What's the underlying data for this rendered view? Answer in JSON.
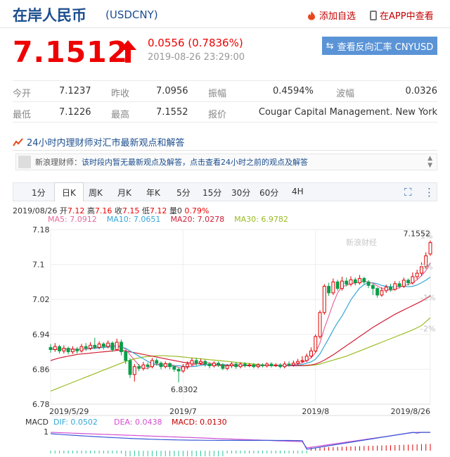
{
  "header": {
    "title": "在岸人民币",
    "code": "(USDCNY)",
    "fav_label": "添加自选",
    "app_label": "在APP中查看"
  },
  "quote": {
    "price": "7.1512",
    "change": "0.0556 (0.7836%)",
    "timestamp": "2019-08-26 23:29:00",
    "reverse_label": "查看反向汇率 CNYUSD"
  },
  "stats": {
    "open_label": "今开",
    "open": "7.1237",
    "prev_label": "昨收",
    "prev": "7.0956",
    "amp_label": "振幅",
    "amp": "0.4594%",
    "wave_label": "波幅",
    "wave": "0.0326",
    "low_label": "最低",
    "low": "7.1226",
    "high_label": "最高",
    "high": "7.1552",
    "quoter_label": "报价",
    "quoter": "Cougar Capital Management. New York"
  },
  "opinion": {
    "heading": "24小时内理财师对汇市最新观点和解答",
    "name": "新浪理财师：",
    "message": "该时段内暂无最新观点及解答，点击查看24小时之前的观点及解答"
  },
  "tabs": [
    "1分",
    "日K",
    "周K",
    "月K",
    "年K",
    "5分",
    "15分",
    "30分",
    "60分",
    "4H"
  ],
  "ohlc": {
    "date": "2019/08/26",
    "open_label": "开",
    "open": "7.12",
    "high_label": "高",
    "high": "7.16",
    "close_label": "收",
    "close": "7.15",
    "low_label": "低",
    "low": "7.12",
    "vol_label": "量",
    "vol": "0",
    "pct": "0.79%",
    "ma5": "MA5: 7.0912",
    "ma10": "MA10: 7.0651",
    "ma20": "MA20: 7.0278",
    "ma30": "MA30: 6.9782"
  },
  "macd": {
    "label": "MACD",
    "dif": "DIF: 0.0502",
    "dea": "DEA: 0.0438",
    "macd": "MACD: 0.0130",
    "tick": "1"
  },
  "colors": {
    "up": "#e00000",
    "down": "#0b9e4a",
    "ma5": "#e8689a",
    "ma10": "#35a7d6",
    "ma20": "#d22038",
    "ma30": "#99bb22"
  },
  "chart_data": {
    "type": "candlestick",
    "y_ticks": [
      "7.18",
      "7.1",
      "7.02",
      "6.94",
      "6.86",
      "6.78"
    ],
    "y_tick_values": [
      7.18,
      7.1,
      7.02,
      6.94,
      6.86,
      6.78
    ],
    "pct_ticks": [
      "2%",
      "1%",
      "0%",
      "-1%",
      "-2%"
    ],
    "x_labels": [
      "2019/5/29",
      "2019/7",
      "2019/8",
      "2019/8/26"
    ],
    "x_label_index": [
      0,
      30,
      60,
      86
    ],
    "ylim": [
      6.78,
      7.18
    ],
    "annotations": [
      {
        "text": "7.1552",
        "index": 86,
        "value": 7.1552
      },
      {
        "text": "6.8302",
        "index": 29,
        "value": 6.8302
      }
    ],
    "watermark": "新浪财经",
    "candles": [
      [
        6.91,
        6.905,
        6.918,
        6.898
      ],
      [
        6.905,
        6.912,
        6.92,
        6.9
      ],
      [
        6.912,
        6.902,
        6.916,
        6.896
      ],
      [
        6.902,
        6.908,
        6.915,
        6.896
      ],
      [
        6.908,
        6.9,
        6.912,
        6.894
      ],
      [
        6.9,
        6.906,
        6.913,
        6.895
      ],
      [
        6.906,
        6.902,
        6.911,
        6.896
      ],
      [
        6.902,
        6.912,
        6.918,
        6.898
      ],
      [
        6.912,
        6.908,
        6.92,
        6.902
      ],
      [
        6.908,
        6.915,
        6.922,
        6.904
      ],
      [
        6.915,
        6.91,
        6.932,
        6.906
      ],
      [
        6.91,
        6.918,
        6.924,
        6.906
      ],
      [
        6.918,
        6.912,
        6.922,
        6.905
      ],
      [
        6.912,
        6.92,
        6.926,
        6.908
      ],
      [
        6.92,
        6.905,
        6.924,
        6.9
      ],
      [
        6.905,
        6.922,
        6.93,
        6.903
      ],
      [
        6.922,
        6.9,
        6.928,
        6.892
      ],
      [
        6.9,
        6.88,
        6.904,
        6.872
      ],
      [
        6.88,
        6.848,
        6.885,
        6.84
      ],
      [
        6.848,
        6.866,
        6.872,
        6.832
      ],
      [
        6.866,
        6.862,
        6.872,
        6.856
      ],
      [
        6.862,
        6.87,
        6.877,
        6.857
      ],
      [
        6.87,
        6.866,
        6.875,
        6.86
      ],
      [
        6.866,
        6.88,
        6.886,
        6.862
      ],
      [
        6.88,
        6.874,
        6.885,
        6.868
      ],
      [
        6.874,
        6.866,
        6.878,
        6.86
      ],
      [
        6.866,
        6.873,
        6.878,
        6.862
      ],
      [
        6.873,
        6.866,
        6.876,
        6.86
      ],
      [
        6.866,
        6.86,
        6.87,
        6.854
      ],
      [
        6.86,
        6.856,
        6.864,
        6.83
      ],
      [
        6.856,
        6.866,
        6.872,
        6.852
      ],
      [
        6.866,
        6.872,
        6.878,
        6.86
      ],
      [
        6.872,
        6.88,
        6.886,
        6.868
      ],
      [
        6.88,
        6.874,
        6.886,
        6.868
      ],
      [
        6.874,
        6.878,
        6.884,
        6.87
      ],
      [
        6.878,
        6.872,
        6.882,
        6.866
      ],
      [
        6.872,
        6.868,
        6.876,
        6.862
      ],
      [
        6.868,
        6.874,
        6.878,
        6.864
      ],
      [
        6.874,
        6.87,
        6.878,
        6.865
      ],
      [
        6.87,
        6.862,
        6.874,
        6.858
      ],
      [
        6.862,
        6.868,
        6.872,
        6.858
      ],
      [
        6.868,
        6.872,
        6.876,
        6.863
      ],
      [
        6.872,
        6.866,
        6.876,
        6.861
      ],
      [
        6.866,
        6.872,
        6.876,
        6.862
      ],
      [
        6.872,
        6.868,
        6.876,
        6.864
      ],
      [
        6.868,
        6.87,
        6.874,
        6.865
      ],
      [
        6.87,
        6.866,
        6.874,
        6.862
      ],
      [
        6.866,
        6.87,
        6.874,
        6.862
      ],
      [
        6.87,
        6.868,
        6.874,
        6.864
      ],
      [
        6.868,
        6.872,
        6.876,
        6.864
      ],
      [
        6.872,
        6.868,
        6.876,
        6.864
      ],
      [
        6.868,
        6.87,
        6.874,
        6.865
      ],
      [
        6.87,
        6.866,
        6.874,
        6.862
      ],
      [
        6.866,
        6.872,
        6.878,
        6.862
      ],
      [
        6.872,
        6.87,
        6.878,
        6.866
      ],
      [
        6.87,
        6.874,
        6.88,
        6.866
      ],
      [
        6.874,
        6.878,
        6.884,
        6.87
      ],
      [
        6.878,
        6.88,
        6.89,
        6.874
      ],
      [
        6.88,
        6.89,
        6.896,
        6.876
      ],
      [
        6.89,
        6.902,
        6.91,
        6.886
      ],
      [
        6.902,
        6.935,
        6.94,
        6.898
      ],
      [
        6.935,
        6.99,
        6.995,
        6.93
      ],
      [
        6.99,
        7.05,
        7.055,
        6.985
      ],
      [
        7.05,
        7.035,
        7.058,
        7.028
      ],
      [
        7.035,
        7.06,
        7.068,
        7.03
      ],
      [
        7.06,
        7.045,
        7.065,
        7.04
      ],
      [
        7.045,
        7.062,
        7.072,
        7.04
      ],
      [
        7.062,
        7.055,
        7.07,
        7.05
      ],
      [
        7.055,
        7.065,
        7.073,
        7.05
      ],
      [
        7.065,
        7.058,
        7.07,
        7.052
      ],
      [
        7.058,
        7.068,
        7.076,
        7.054
      ],
      [
        7.068,
        7.06,
        7.072,
        7.054
      ],
      [
        7.06,
        7.052,
        7.064,
        7.046
      ],
      [
        7.052,
        7.045,
        7.056,
        7.03
      ],
      [
        7.045,
        7.03,
        7.048,
        7.024
      ],
      [
        7.03,
        7.04,
        7.048,
        7.026
      ],
      [
        7.04,
        7.048,
        7.054,
        7.035
      ],
      [
        7.048,
        7.043,
        7.056,
        7.038
      ],
      [
        7.043,
        7.056,
        7.062,
        7.04
      ],
      [
        7.056,
        7.05,
        7.062,
        7.045
      ],
      [
        7.05,
        7.064,
        7.07,
        7.046
      ],
      [
        7.064,
        7.058,
        7.068,
        7.052
      ],
      [
        7.058,
        7.072,
        7.082,
        7.054
      ],
      [
        7.072,
        7.08,
        7.088,
        7.066
      ],
      [
        7.08,
        7.095,
        7.105,
        7.074
      ],
      [
        7.095,
        7.12,
        7.128,
        7.09
      ],
      [
        7.124,
        7.15,
        7.155,
        7.12
      ]
    ],
    "ma5": [
      6.907,
      6.906,
      6.906,
      6.906,
      6.906,
      6.906,
      6.906,
      6.906,
      6.906,
      6.908,
      6.91,
      6.912,
      6.913,
      6.914,
      6.914,
      6.915,
      6.912,
      6.906,
      6.893,
      6.881,
      6.869,
      6.862,
      6.862,
      6.868,
      6.872,
      6.871,
      6.872,
      6.872,
      6.868,
      6.864,
      6.862,
      6.864,
      6.868,
      6.872,
      6.875,
      6.876,
      6.874,
      6.872,
      6.871,
      6.87,
      6.868,
      6.869,
      6.869,
      6.868,
      6.869,
      6.869,
      6.868,
      6.868,
      6.868,
      6.869,
      6.869,
      6.869,
      6.869,
      6.869,
      6.87,
      6.87,
      6.872,
      6.875,
      6.88,
      6.886,
      6.898,
      6.92,
      6.954,
      6.982,
      7.011,
      7.035,
      7.049,
      7.052,
      7.057,
      7.057,
      7.061,
      7.061,
      7.06,
      7.057,
      7.051,
      7.045,
      7.043,
      7.041,
      7.043,
      7.047,
      7.052,
      7.054,
      7.058,
      7.065,
      7.074,
      7.086,
      7.104
    ],
    "ma10": [
      6.906,
      6.906,
      6.906,
      6.906,
      6.906,
      6.906,
      6.906,
      6.906,
      6.906,
      6.907,
      6.908,
      6.909,
      6.91,
      6.911,
      6.911,
      6.912,
      6.911,
      6.908,
      6.902,
      6.896,
      6.89,
      6.884,
      6.878,
      6.873,
      6.871,
      6.869,
      6.867,
      6.867,
      6.868,
      6.868,
      6.867,
      6.866,
      6.866,
      6.867,
      6.869,
      6.87,
      6.87,
      6.871,
      6.871,
      6.871,
      6.87,
      6.87,
      6.869,
      6.869,
      6.869,
      6.869,
      6.869,
      6.869,
      6.869,
      6.868,
      6.868,
      6.868,
      6.868,
      6.868,
      6.869,
      6.869,
      6.87,
      6.871,
      6.874,
      6.877,
      6.883,
      6.895,
      6.913,
      6.931,
      6.95,
      6.967,
      6.982,
      7.0,
      7.019,
      7.033,
      7.046,
      7.054,
      7.058,
      7.058,
      7.056,
      7.052,
      7.05,
      7.049,
      7.049,
      7.05,
      7.05,
      7.049,
      7.05,
      7.053,
      7.058,
      7.064,
      7.071
    ],
    "ma20": [
      6.88,
      6.883,
      6.886,
      6.888,
      6.89,
      6.892,
      6.894,
      6.895,
      6.896,
      6.897,
      6.898,
      6.899,
      6.9,
      6.901,
      6.902,
      6.903,
      6.903,
      6.902,
      6.9,
      6.898,
      6.896,
      6.894,
      6.892,
      6.89,
      6.888,
      6.886,
      6.884,
      6.882,
      6.88,
      6.878,
      6.876,
      6.875,
      6.874,
      6.873,
      6.872,
      6.871,
      6.87,
      6.869,
      6.869,
      6.868,
      6.868,
      6.868,
      6.868,
      6.868,
      6.868,
      6.868,
      6.868,
      6.868,
      6.868,
      6.868,
      6.868,
      6.868,
      6.868,
      6.868,
      6.868,
      6.868,
      6.868,
      6.868,
      6.869,
      6.87,
      6.872,
      6.876,
      6.881,
      6.887,
      6.893,
      6.9,
      6.907,
      6.914,
      6.921,
      6.928,
      6.935,
      6.942,
      6.949,
      6.956,
      6.962,
      6.968,
      6.974,
      6.98,
      6.986,
      6.991,
      6.996,
      7.001,
      7.006,
      7.011,
      7.016,
      7.022,
      7.028
    ],
    "ma30": [
      6.81,
      6.814,
      6.818,
      6.822,
      6.826,
      6.83,
      6.834,
      6.838,
      6.842,
      6.846,
      6.85,
      6.854,
      6.858,
      6.862,
      6.866,
      6.87,
      6.874,
      6.878,
      6.881,
      6.884,
      6.886,
      6.888,
      6.889,
      6.89,
      6.891,
      6.891,
      6.891,
      6.89,
      6.89,
      6.889,
      6.888,
      6.887,
      6.886,
      6.885,
      6.884,
      6.883,
      6.882,
      6.881,
      6.88,
      6.879,
      6.878,
      6.877,
      6.876,
      6.875,
      6.874,
      6.873,
      6.872,
      6.871,
      6.87,
      6.869,
      6.868,
      6.868,
      6.868,
      6.868,
      6.868,
      6.868,
      6.868,
      6.868,
      6.868,
      6.869,
      6.87,
      6.872,
      6.875,
      6.878,
      6.881,
      6.884,
      6.887,
      6.89,
      6.894,
      6.898,
      6.902,
      6.906,
      6.91,
      6.914,
      6.918,
      6.922,
      6.926,
      6.93,
      6.934,
      6.938,
      6.942,
      6.946,
      6.95,
      6.955,
      6.96,
      6.969,
      6.978
    ]
  }
}
